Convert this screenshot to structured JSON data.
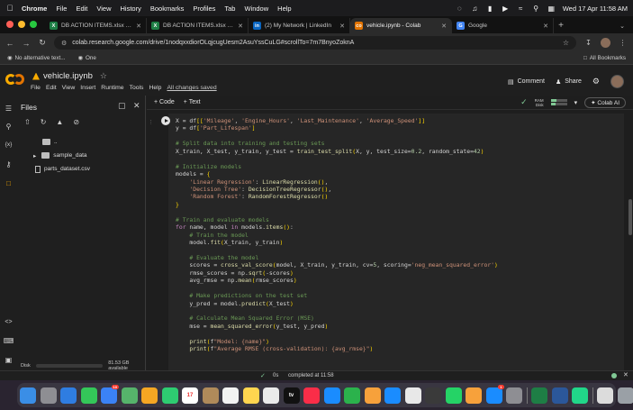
{
  "menubar": {
    "app": "Chrome",
    "items": [
      "File",
      "Edit",
      "View",
      "History",
      "Bookmarks",
      "Profiles",
      "Tab",
      "Window",
      "Help"
    ],
    "datetime": "Wed 17 Apr  11:58 AM"
  },
  "tabs": [
    {
      "label": "DB ACTION ITEMS.xlsx - Mic",
      "fav": "X",
      "favcolor": "#1e7e45",
      "active": false
    },
    {
      "label": "DB ACTION ITEMS.xlsx - Mic",
      "fav": "X",
      "favcolor": "#1e7e45",
      "active": false
    },
    {
      "label": "(2) My Network | LinkedIn",
      "fav": "in",
      "favcolor": "#0a66c2",
      "active": false
    },
    {
      "label": "vehicle.ipynb - Colab",
      "fav": "co",
      "favcolor": "#e37400",
      "active": true
    },
    {
      "label": "Google",
      "fav": "G",
      "favcolor": "#4285f4",
      "active": false
    }
  ],
  "address": {
    "url": "colab.research.google.com/drive/1nodqxxdiorOLqjcugUesm2AsuYssCuLG#scrollTo=7m7BnyoZoknA"
  },
  "bookmarks": {
    "item1": "No alternative text...",
    "item2": "One",
    "all": "All Bookmarks"
  },
  "colab": {
    "title": "vehicle.ipynb",
    "menu": [
      "File",
      "Edit",
      "View",
      "Insert",
      "Runtime",
      "Tools",
      "Help"
    ],
    "saved": "All changes saved",
    "comment": "Comment",
    "share": "Share"
  },
  "files": {
    "header": "Files",
    "tree": [
      {
        "name": "..",
        "type": "folder",
        "indent": 0
      },
      {
        "name": "sample_data",
        "type": "folder",
        "indent": 0
      },
      {
        "name": "parts_dataset.csv",
        "type": "file",
        "indent": 1
      }
    ],
    "disk_label": "Disk",
    "disk_avail": "81.53 GB available",
    "disk_used_fraction": 0.3
  },
  "notebook": {
    "add_code": "+ Code",
    "add_text": "+ Text",
    "ram": "RAM",
    "disk": "Disk",
    "ram_fraction": 0.35,
    "disk_fraction": 0.3,
    "colab_ai": "Colab AI"
  },
  "status": {
    "seconds": "0s",
    "completed": "completed at 11:58"
  },
  "dock": [
    {
      "name": "finder",
      "color": "#3a8ee6"
    },
    {
      "name": "launchpad",
      "color": "#8e8e93"
    },
    {
      "name": "safari",
      "color": "#2f7de1"
    },
    {
      "name": "messages",
      "color": "#34c759"
    },
    {
      "name": "mail",
      "color": "#3b82f6",
      "badge": "10"
    },
    {
      "name": "maps",
      "color": "#56b36b"
    },
    {
      "name": "photos",
      "color": "#f5a623"
    },
    {
      "name": "facetime",
      "color": "#2ecc71"
    },
    {
      "name": "calendar",
      "color": "#ffffff",
      "text": "17"
    },
    {
      "name": "contacts",
      "color": "#b08a5a"
    },
    {
      "name": "reminders",
      "color": "#f2f2f2"
    },
    {
      "name": "notes",
      "color": "#ffd54f"
    },
    {
      "name": "freeform",
      "color": "#eaeaea"
    },
    {
      "name": "tv",
      "color": "#111111",
      "text": "tv"
    },
    {
      "name": "music",
      "color": "#fa2d48"
    },
    {
      "name": "keynote",
      "color": "#1a8cff"
    },
    {
      "name": "numbers",
      "color": "#2bb24c"
    },
    {
      "name": "pages",
      "color": "#f7a13b"
    },
    {
      "name": "app-store",
      "color": "#1a8cff"
    },
    {
      "name": "chrome",
      "color": "#e8e8e8"
    },
    {
      "name": "terminal",
      "color": "#3a3a3a"
    },
    {
      "name": "whatsapp",
      "color": "#25d366"
    },
    {
      "name": "sublime",
      "color": "#f7a13b"
    },
    {
      "name": "xcode",
      "color": "#1a8cff",
      "badge": "1"
    },
    {
      "name": "settings",
      "color": "#8e8e93"
    },
    {
      "name": "excel",
      "color": "#1e7e45"
    },
    {
      "name": "word",
      "color": "#2b579a"
    },
    {
      "name": "pycharm",
      "color": "#21d789"
    },
    {
      "name": "preview",
      "color": "#dcdcdc"
    },
    {
      "name": "trash",
      "color": "#9aa0a6"
    }
  ],
  "code_lines": [
    "X = df[['Mileage', 'Engine_Hours', 'Last_Maintenance', 'Average_Speed']]",
    "y = df['Part_Lifespan']",
    "",
    "# Split data into training and testing sets",
    "X_train, X_test, y_train, y_test = train_test_split(X, y, test_size=0.2, random_state=42)",
    "",
    "# Initialize models",
    "models = {",
    "    'Linear Regression': LinearRegression(),",
    "    'Decision Tree': DecisionTreeRegressor(),",
    "    'Random Forest': RandomForestRegressor()",
    "}",
    "",
    "# Train and evaluate models",
    "for name, model in models.items():",
    "    # Train the model",
    "    model.fit(X_train, y_train)",
    "",
    "    # Evaluate the model",
    "    scores = cross_val_score(model, X_train, y_train, cv=5, scoring='neg_mean_squared_error')",
    "    rmse_scores = np.sqrt(-scores)",
    "    avg_rmse = np.mean(rmse_scores)",
    "",
    "    # Make predictions on the test set",
    "    y_pred = model.predict(X_test)",
    "",
    "    # Calculate Mean Squared Error (MSE)",
    "    mse = mean_squared_error(y_test, y_pred)",
    "",
    "    print(f\"Model: {name}\")",
    "    print(f\"Average RMSE (cross-validation): {avg_rmse}\")"
  ]
}
